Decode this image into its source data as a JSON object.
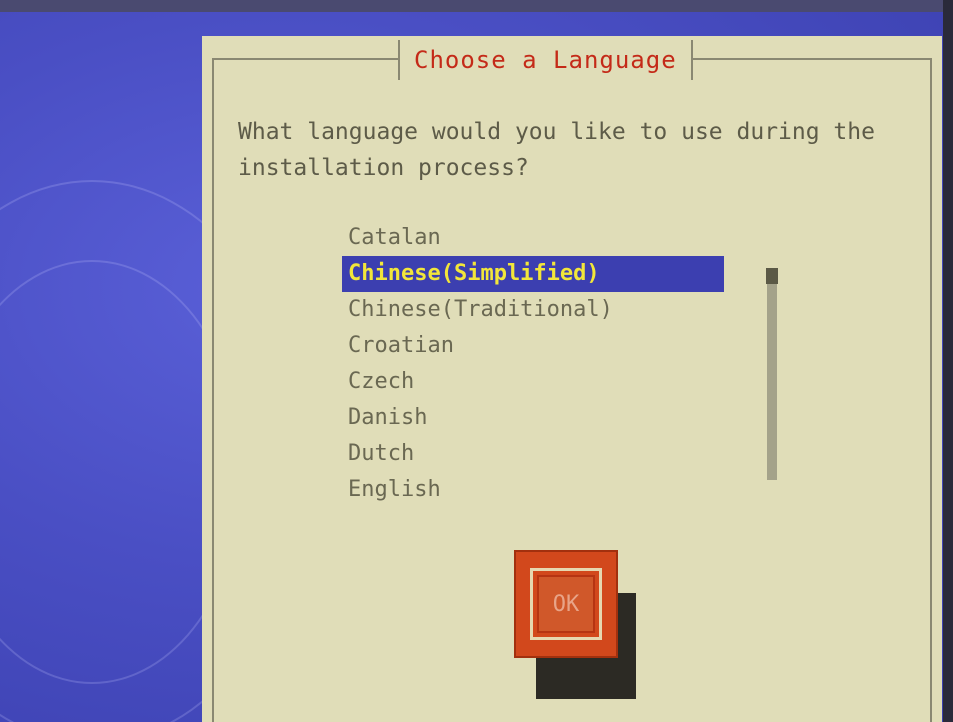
{
  "dialog": {
    "title": "Choose a Language",
    "prompt": "What language would you like to use during the installation process?",
    "languages": [
      "Catalan",
      "Chinese(Simplified)",
      "Chinese(Traditional)",
      "Croatian",
      "Czech",
      "Danish",
      "Dutch",
      "English"
    ],
    "selected_language": "Chinese(Simplified)",
    "ok_label": "OK"
  },
  "colors": {
    "background": "#4a4fc4",
    "dialog": "#e0ddb8",
    "title": "#c42a18",
    "selection_bg": "#3c3fb0",
    "selection_text": "#f2e63a",
    "button": "#d2481c"
  }
}
